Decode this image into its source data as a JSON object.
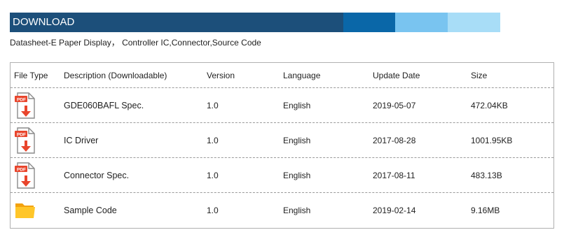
{
  "header": {
    "title": "DOWNLOAD",
    "colors": [
      "#1c4f7a",
      "#0a67a8",
      "#79c4f0",
      "#a8ddf7"
    ]
  },
  "subtitle": "Datasheet-E Paper Display， Controller IC,Connector,Source Code",
  "table": {
    "columns": [
      "File Type",
      "Description (Downloadable)",
      "Version",
      "Language",
      "Update Date",
      "Size"
    ],
    "rows": [
      {
        "icon": "pdf-icon",
        "description": "GDE060BAFL Spec.",
        "version": "1.0",
        "language": "English",
        "date": "2019-05-07",
        "size": "472.04KB"
      },
      {
        "icon": "pdf-icon",
        "description": "IC Driver",
        "version": "1.0",
        "language": "English",
        "date": "2017-08-28",
        "size": "1001.95KB"
      },
      {
        "icon": "pdf-icon",
        "description": "Connector Spec.",
        "version": "1.0",
        "language": "English",
        "date": "2017-08-11",
        "size": "483.13B"
      },
      {
        "icon": "folder-icon",
        "description": "Sample Code",
        "version": "1.0",
        "language": "English",
        "date": "2019-02-14",
        "size": "9.16MB"
      }
    ]
  }
}
